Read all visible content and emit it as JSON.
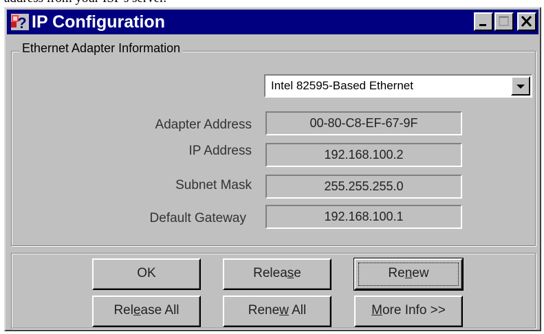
{
  "page_caption": "address from your ISP's server.",
  "window": {
    "title": "IP Configuration",
    "icon": "ip-config-app-icon",
    "controls": {
      "minimize": "minimize-icon",
      "maximize": "maximize-icon",
      "close": "close-icon"
    }
  },
  "ethernet_group": {
    "label": "Ethernet Adapter Information",
    "adapter_select": {
      "selected": "Intel 82595-Based Ethernet",
      "arrow_icon": "chevron-down-icon"
    },
    "fields": {
      "adapter_address": {
        "label": "Adapter Address",
        "value": "00-80-C8-EF-67-9F"
      },
      "ip_address": {
        "label": "IP Address",
        "value": "192.168.100.2"
      },
      "subnet_mask": {
        "label": "Subnet Mask",
        "value": "255.255.255.0"
      },
      "default_gateway": {
        "label": "Default Gateway",
        "value": "192.168.100.1"
      }
    }
  },
  "buttons": {
    "ok": {
      "label": "OK"
    },
    "release": {
      "before": "Relea",
      "mnemonic": "s",
      "after": "e"
    },
    "renew": {
      "before": "Re",
      "mnemonic": "n",
      "after": "ew"
    },
    "release_all": {
      "before": "Rel",
      "mnemonic": "e",
      "after": "ase All"
    },
    "renew_all": {
      "before": "Rene",
      "mnemonic": "w",
      "after": " All"
    },
    "more_info": {
      "before": "",
      "mnemonic": "M",
      "after": "ore Info >>"
    }
  },
  "colors": {
    "titlebar": "#000080",
    "face": "#c0c0c0",
    "title_text": "#ffffff"
  }
}
